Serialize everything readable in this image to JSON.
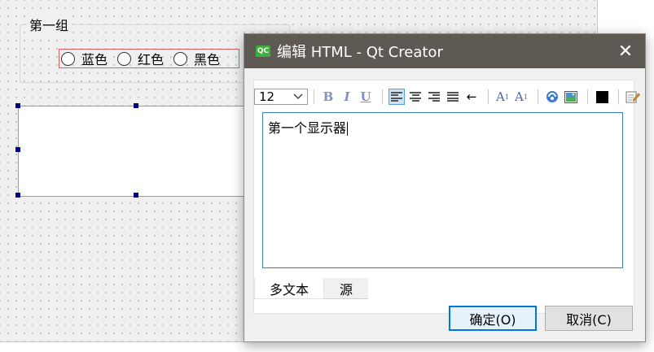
{
  "designer": {
    "group_title": "第一组",
    "radios": [
      {
        "label": "蓝色"
      },
      {
        "label": "红色"
      },
      {
        "label": "黑色"
      }
    ]
  },
  "dialog": {
    "app_icon": "qt-creator-icon",
    "icon_text": "QC",
    "title": "编辑 HTML - Qt Creator",
    "close_glyph": "✕",
    "toolbar": {
      "font_size": "12",
      "bold": "B",
      "italic": "I",
      "underline": "U",
      "ltr_arrow": "←",
      "superscript": "A",
      "superscript_mark": "1",
      "subscript": "A",
      "subscript_mark": "1",
      "text_color": "#000000"
    },
    "editor_text": "第一个显示器",
    "tabs": [
      {
        "label": "多文本",
        "active": true
      },
      {
        "label": "源",
        "active": false
      }
    ],
    "ok_label": "确定(O)",
    "cancel_label": "取消(C)"
  },
  "colors": {
    "titlebar": "#5f5953",
    "accent": "#0078d7",
    "selection_frame": "#e06060",
    "handle": "#000080"
  }
}
